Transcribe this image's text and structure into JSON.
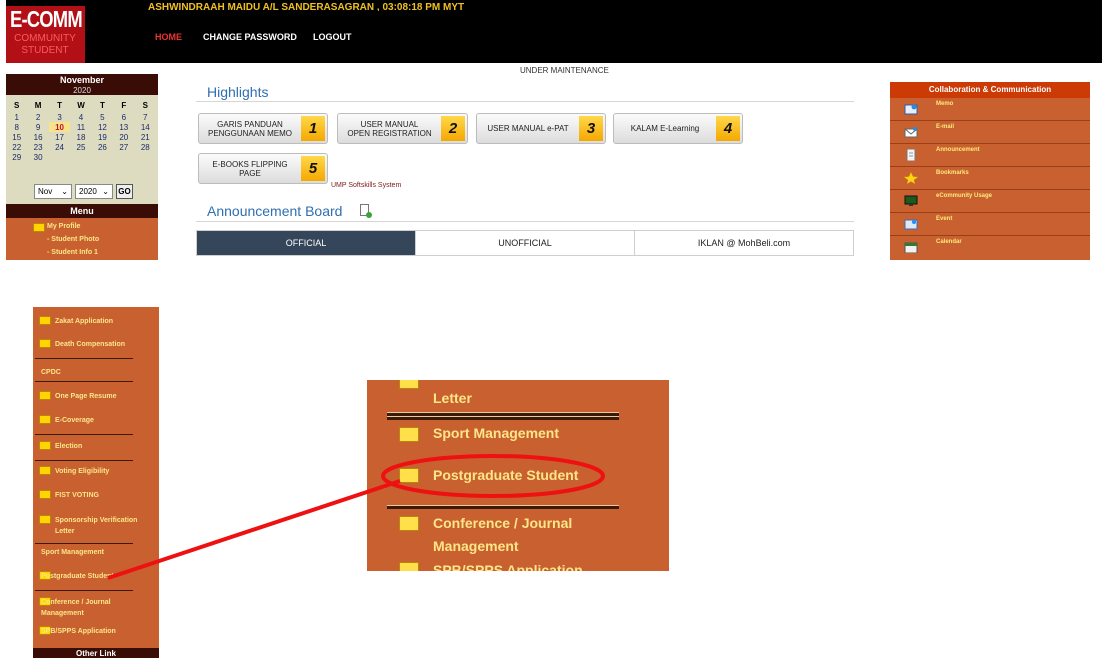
{
  "header": {
    "logo_line1": "E-COMM",
    "logo_line2": "COMMUNITY",
    "logo_line3": "STUDENT",
    "user_line": "ASHWINDRAAH MAIDU A/L SANDERASAGRAN , 03:08:18 PM MYT",
    "nav": {
      "home": "HOME",
      "change_password": "CHANGE PASSWORD",
      "logout": "LOGOUT"
    },
    "maintenance": "UNDER MAINTENANCE"
  },
  "calendar": {
    "month": "November",
    "year": "2020",
    "weekdays": [
      "S",
      "M",
      "T",
      "W",
      "T",
      "F",
      "S"
    ],
    "weeks": [
      [
        "1",
        "2",
        "3",
        "4",
        "5",
        "6",
        "7"
      ],
      [
        "8",
        "9",
        "10",
        "11",
        "12",
        "13",
        "14"
      ],
      [
        "15",
        "16",
        "17",
        "18",
        "19",
        "20",
        "21"
      ],
      [
        "22",
        "23",
        "24",
        "25",
        "26",
        "27",
        "28"
      ],
      [
        "29",
        "30",
        "",
        "",
        "",
        "",
        ""
      ]
    ],
    "today": "10",
    "month_select": "Nov",
    "year_select": "2020",
    "go_label": "GO"
  },
  "menu": {
    "title": "Menu",
    "top_items": [
      "My Profile",
      "- Student Photo",
      "- Student Info 1"
    ],
    "lower_items": {
      "zakat": "Zakat Application",
      "death": "Death Compensation",
      "cpdc": "CPDC",
      "resume": "One Page Resume",
      "ecoverage": "E-Coverage",
      "election": "Election",
      "voting": "Voting Eligibility",
      "fist": "FIST VOTING",
      "sponsorship_1": "Sponsorship Verification",
      "sponsorship_2": "Letter",
      "sport": "Sport Management",
      "postgrad": "Postgraduate Student",
      "conference_1": "Conference / Journal",
      "conference_2": "Management",
      "spb": "SPB/SPPS Application"
    },
    "other_link": "Other Link"
  },
  "highlights": {
    "title": "Highlights",
    "buttons": [
      {
        "label": "GARIS PANDUAN\nPENGGUNAAN MEMO",
        "num": "1"
      },
      {
        "label": "USER MANUAL\nOPEN REGISTRATION",
        "num": "2"
      },
      {
        "label": "USER MANUAL e-PAT",
        "num": "3"
      },
      {
        "label": "KALAM E-Learning",
        "num": "4"
      },
      {
        "label": "E-BOOKS FLIPPING PAGE",
        "num": "5"
      }
    ],
    "softskills": "UMP Softskills System"
  },
  "announcement": {
    "title": "Announcement Board",
    "tabs": [
      "OFFICIAL",
      "UNOFFICIAL",
      "IKLAN @ MohBeli.com"
    ]
  },
  "collab": {
    "title": "Collaboration & Communication",
    "items": [
      {
        "label": "Memo",
        "icon": "memo-icon"
      },
      {
        "label": "E-mail",
        "icon": "email-icon"
      },
      {
        "label": "Announcement",
        "icon": "announcement-icon"
      },
      {
        "label": "Bookmarks",
        "icon": "star-icon"
      },
      {
        "label": "eCommunity Usage",
        "icon": "monitor-icon"
      },
      {
        "label": "Event",
        "icon": "event-icon"
      },
      {
        "label": "Calendar",
        "icon": "calendar-icon"
      }
    ]
  },
  "zoom": {
    "letter": "Letter",
    "sport": "Sport Management",
    "postgrad": "Postgraduate Student",
    "conference_1": "Conference / Journal",
    "conference_2": "Management",
    "spb_partial": "SPB/SPPS Application"
  },
  "colors": {
    "menu_bg": "#c8612f",
    "menu_text": "#fde68a",
    "header": "#000000",
    "annotation": "#ee1111",
    "accent_blue": "#2f6fb0"
  }
}
